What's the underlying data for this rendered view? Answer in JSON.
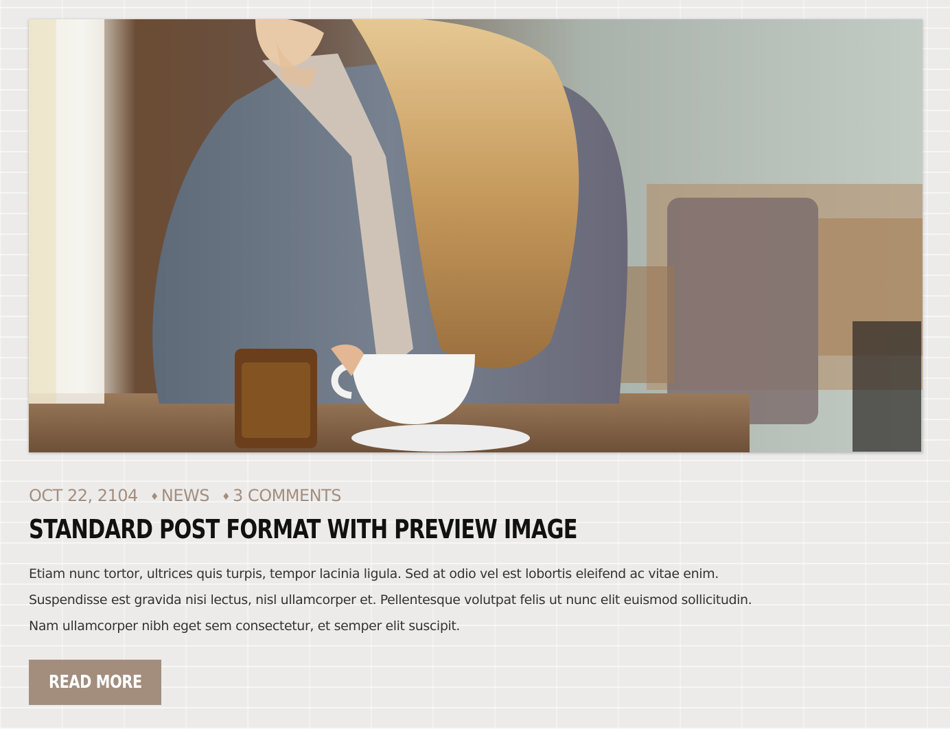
{
  "post": {
    "image_alt": "Woman with coffee cup at cafe table",
    "meta": {
      "date": "OCT 22, 2104",
      "category": "NEWS",
      "comments": "3 COMMENTS",
      "separator": "♦"
    },
    "title": "STANDARD POST FORMAT WITH PREVIEW IMAGE",
    "excerpt_lines": [
      "Etiam nunc tortor, ultrices quis turpis, tempor lacinia ligula. Sed at odio vel est lobortis eleifend ac vitae enim.",
      "Suspendisse est gravida nisi lectus, nisl ullamcorper et. Pellentesque volutpat felis ut nunc elit euismod sollicitudin.",
      "Nam ullamcorper nibh eget sem consectetur, et semper elit suscipit."
    ],
    "read_more_label": "READ MORE"
  },
  "colors": {
    "accent": "#a38e7e",
    "title": "#111111",
    "body_text": "#333333",
    "background": "#ecebea"
  }
}
